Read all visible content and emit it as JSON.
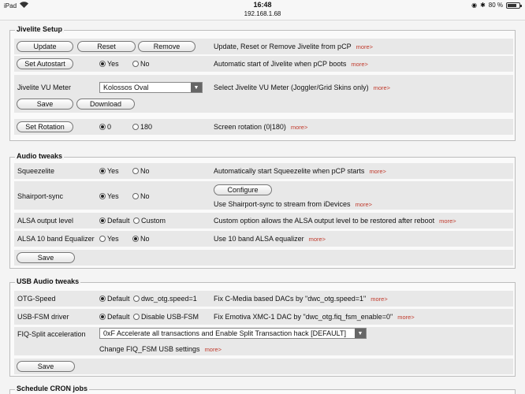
{
  "status": {
    "device": "iPad",
    "time": "16:48",
    "url": "192.168.1.68",
    "battery": "80 %",
    "battery_level": 0.8
  },
  "jivelite": {
    "title": "Jivelite Setup",
    "update": "Update",
    "reset": "Reset",
    "remove": "Remove",
    "update_desc": "Update, Reset or Remove Jivelite from pCP",
    "autostart": "Set Autostart",
    "yes": "Yes",
    "no": "No",
    "autostart_desc": "Automatic start of Jivelite when pCP boots",
    "vu_label": "Jivelite VU Meter",
    "vu_value": "Kolossos Oval",
    "vu_desc": "Select Jivelite VU Meter (Joggler/Grid Skins only)",
    "save": "Save",
    "download": "Download",
    "rotation": "Set Rotation",
    "rot0": "0",
    "rot180": "180",
    "rotation_desc": "Screen rotation (0|180)"
  },
  "audio": {
    "title": "Audio tweaks",
    "squeeze": "Squeezelite",
    "squeeze_desc": "Automatically start Squeezelite when pCP starts",
    "shairport": "Shairport-sync",
    "configure": "Configure",
    "shairport_desc": "Use Shairport-sync to stream from iDevices",
    "alsa": "ALSA output level",
    "default": "Default",
    "custom": "Custom",
    "alsa_desc": "Custom option allows the ALSA output level to be restored after reboot",
    "eq": "ALSA 10 band Equalizer",
    "eq_desc": "Use 10 band ALSA equalizer",
    "yes": "Yes",
    "no": "No",
    "save": "Save"
  },
  "usb": {
    "title": "USB Audio tweaks",
    "otg": "OTG-Speed",
    "default": "Default",
    "otg_alt": "dwc_otg.speed=1",
    "otg_desc": "Fix C-Media based DACs by \"dwc_otg.speed=1\"",
    "fsm": "USB-FSM driver",
    "fsm_alt": "Disable USB-FSM",
    "fsm_desc": "Fix Emotiva XMC-1 DAC by \"dwc_otg.fiq_fsm_enable=0\"",
    "fiq": "FIQ-Split acceleration",
    "fiq_value": "0xF Accelerate all transactions and Enable Split Transaction hack [DEFAULT]",
    "fiq_desc": "Change FIQ_FSM USB settings",
    "save": "Save"
  },
  "cron": {
    "title": "Schedule CRON jobs"
  },
  "more": "more>"
}
